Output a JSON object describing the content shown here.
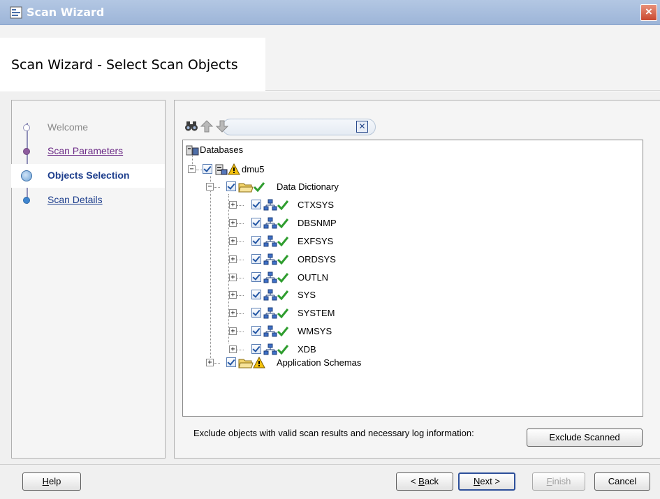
{
  "window": {
    "title": "Scan Wizard"
  },
  "header": {
    "title": "Scan Wizard - Select Scan Objects"
  },
  "steps": [
    {
      "label": "Welcome",
      "state": "visited"
    },
    {
      "label": "Scan Parameters",
      "state": "visited"
    },
    {
      "label": "Objects Selection",
      "state": "current"
    },
    {
      "label": "Scan Details",
      "state": "next"
    }
  ],
  "toolbar": {
    "find_icon": "binoculars-icon",
    "up_icon": "arrow-up-icon",
    "down_icon": "arrow-down-icon",
    "clear_icon": "clear-filter-icon"
  },
  "tree": {
    "root": "Databases",
    "database": "dmu5",
    "data_dictionary": "Data Dictionary",
    "schemas": [
      "CTXSYS",
      "DBSNMP",
      "EXFSYS",
      "ORDSYS",
      "OUTLN",
      "SYS",
      "SYSTEM",
      "WMSYS",
      "XDB"
    ],
    "application_schemas": "Application Schemas"
  },
  "exclude": {
    "description": "Exclude objects with valid scan results and necessary log information:",
    "button": "Exclude Scanned"
  },
  "buttons": {
    "help": {
      "mnemonic": "H",
      "rest": "elp"
    },
    "back": {
      "prefix": "< ",
      "mnemonic": "B",
      "rest": "ack"
    },
    "next": {
      "mnemonic": "N",
      "rest": "ext >"
    },
    "finish": {
      "mnemonic": "F",
      "rest": "inish"
    },
    "cancel": "Cancel"
  },
  "colors": {
    "titlebar": "#9db5d8",
    "accent": "#2d4f9a",
    "link_visited": "#6b2a86",
    "link": "#1c3d8c"
  }
}
